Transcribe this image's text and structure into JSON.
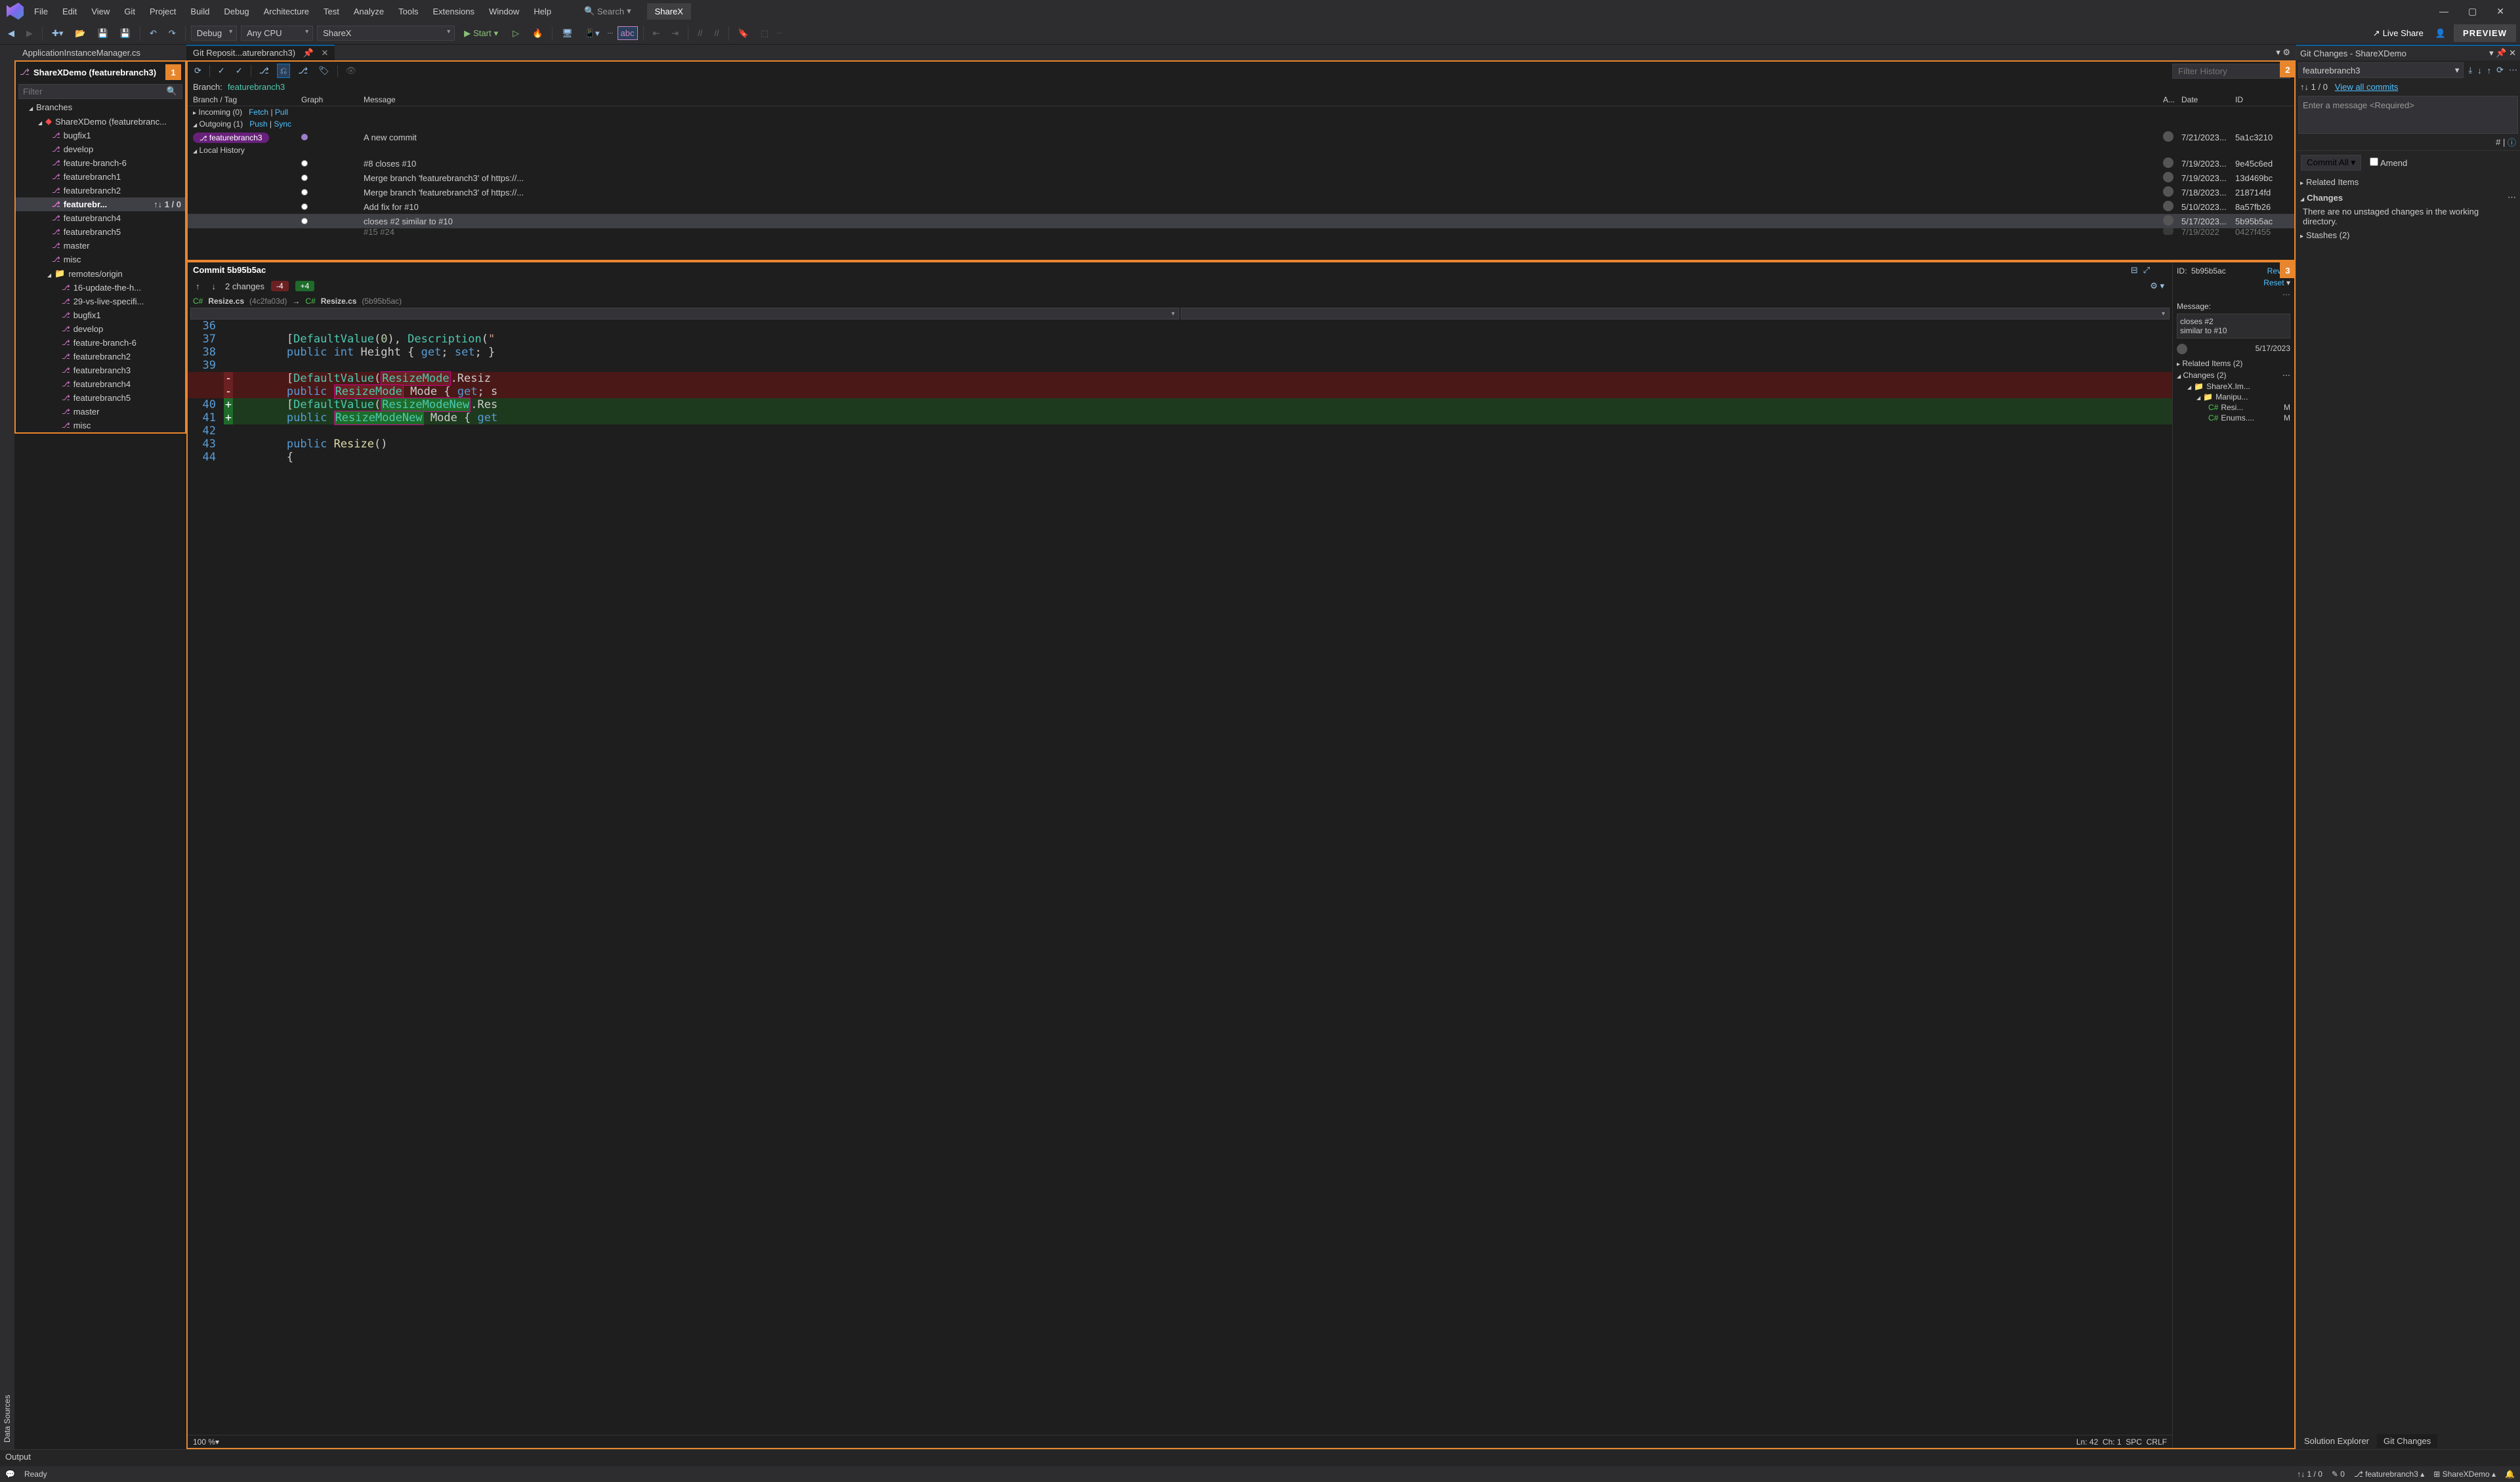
{
  "menu": [
    "File",
    "Edit",
    "View",
    "Git",
    "Project",
    "Build",
    "Debug",
    "Architecture",
    "Test",
    "Analyze",
    "Tools",
    "Extensions",
    "Window",
    "Help"
  ],
  "search_placeholder": "Search",
  "solution_pill": "ShareX",
  "preview_btn": "PREVIEW",
  "toolbar": {
    "config": "Debug",
    "platform": "Any CPU",
    "target": "ShareX",
    "start": "Start",
    "live_share": "Live Share"
  },
  "docTabs": {
    "inactive": "ApplicationInstanceManager.cs",
    "active": "Git Reposit...aturebranch3)"
  },
  "data_sources": "Data Sources",
  "repoPanel": {
    "title": "ShareXDemo (featurebranch3)",
    "badge": "1",
    "filter_placeholder": "Filter",
    "branches_label": "Branches",
    "repo_root": "ShareXDemo (featurebranc...",
    "local": [
      "bugfix1",
      "develop",
      "feature-branch-6",
      "featurebranch1",
      "featurebranch2"
    ],
    "current": {
      "name": "featurebr...",
      "up": "1",
      "down": "0"
    },
    "local2": [
      "featurebranch4",
      "featurebranch5",
      "master",
      "misc"
    ],
    "remotes_label": "remotes/origin",
    "remotes": [
      "16-update-the-h...",
      "29-vs-live-specifi...",
      "bugfix1",
      "develop",
      "feature-branch-6",
      "featurebranch2",
      "featurebranch3",
      "featurebranch4",
      "featurebranch5",
      "master",
      "misc"
    ]
  },
  "history": {
    "badge": "2",
    "filter_placeholder": "Filter History",
    "branch_label": "Branch:",
    "branch_value": "featurebranch3",
    "cols": {
      "branchtag": "Branch / Tag",
      "graph": "Graph",
      "message": "Message",
      "author": "A...",
      "date": "Date",
      "id": "ID"
    },
    "incoming": "Incoming (0)",
    "fetch": "Fetch",
    "pull": "Pull",
    "outgoing": "Outgoing (1)",
    "push": "Push",
    "sync": "Sync",
    "outgoing_commit": {
      "branch": "featurebranch3",
      "message": "A new commit",
      "date": "7/21/2023...",
      "id": "5a1c3210"
    },
    "local_history": "Local History",
    "commits": [
      {
        "message": "#8 closes #10",
        "date": "7/19/2023...",
        "id": "9e45c6ed"
      },
      {
        "message": "Merge branch 'featurebranch3' of https://...",
        "date": "7/19/2023...",
        "id": "13d469bc"
      },
      {
        "message": "Merge branch 'featurebranch3' of https://...",
        "date": "7/18/2023...",
        "id": "218714fd"
      },
      {
        "message": "Add fix for #10",
        "date": "5/10/2023...",
        "id": "8a57fb26"
      },
      {
        "message": "closes #2 similar to #10",
        "date": "5/17/2023...",
        "id": "5b95b5ac"
      }
    ],
    "cutoff": {
      "msg": "#15 #24",
      "date": "7/19/2022",
      "id": "0427f455"
    }
  },
  "diff": {
    "badge": "3",
    "commit_title": "Commit 5b95b5ac",
    "changes_count": "2 changes",
    "minus": "-4",
    "plus": "+4",
    "file_left": "Resize.cs",
    "hash_left": "(4c2fa03d)",
    "file_right": "Resize.cs",
    "hash_right": "(5b95b5ac)",
    "side": {
      "id_label": "ID:",
      "id": "5b95b5ac",
      "revert": "Revert",
      "reset": "Reset",
      "message_label": "Message:",
      "message": "closes #2\nsimilar to #10",
      "date": "5/17/2023",
      "related": "Related Items (2)",
      "changes": "Changes (2)",
      "folder1": "ShareX.Im...",
      "folder2": "Manipu...",
      "file1": "Resi...",
      "file1_m": "M",
      "file2": "Enums....",
      "file2_m": "M"
    },
    "status": {
      "zoom": "100 %",
      "ln": "Ln: 42",
      "ch": "Ch: 1",
      "spc": "SPC",
      "crlf": "CRLF"
    }
  },
  "gitChanges": {
    "title": "Git Changes - ShareXDemo",
    "branch": "featurebranch3",
    "updown": "1 / 0",
    "view_all": "View all commits",
    "commit_placeholder": "Enter a message <Required>",
    "commit_all": "Commit All",
    "amend": "Amend",
    "related": "Related Items",
    "changes": "Changes",
    "no_changes": "There are no unstaged changes in the working directory.",
    "stashes": "Stashes (2)",
    "tabs": {
      "se": "Solution Explorer",
      "gc": "Git Changes"
    }
  },
  "output": "Output",
  "statusbar": {
    "ready": "Ready",
    "updown": "1 / 0",
    "changes": "0",
    "branch": "featurebranch3",
    "repo": "ShareXDemo"
  }
}
